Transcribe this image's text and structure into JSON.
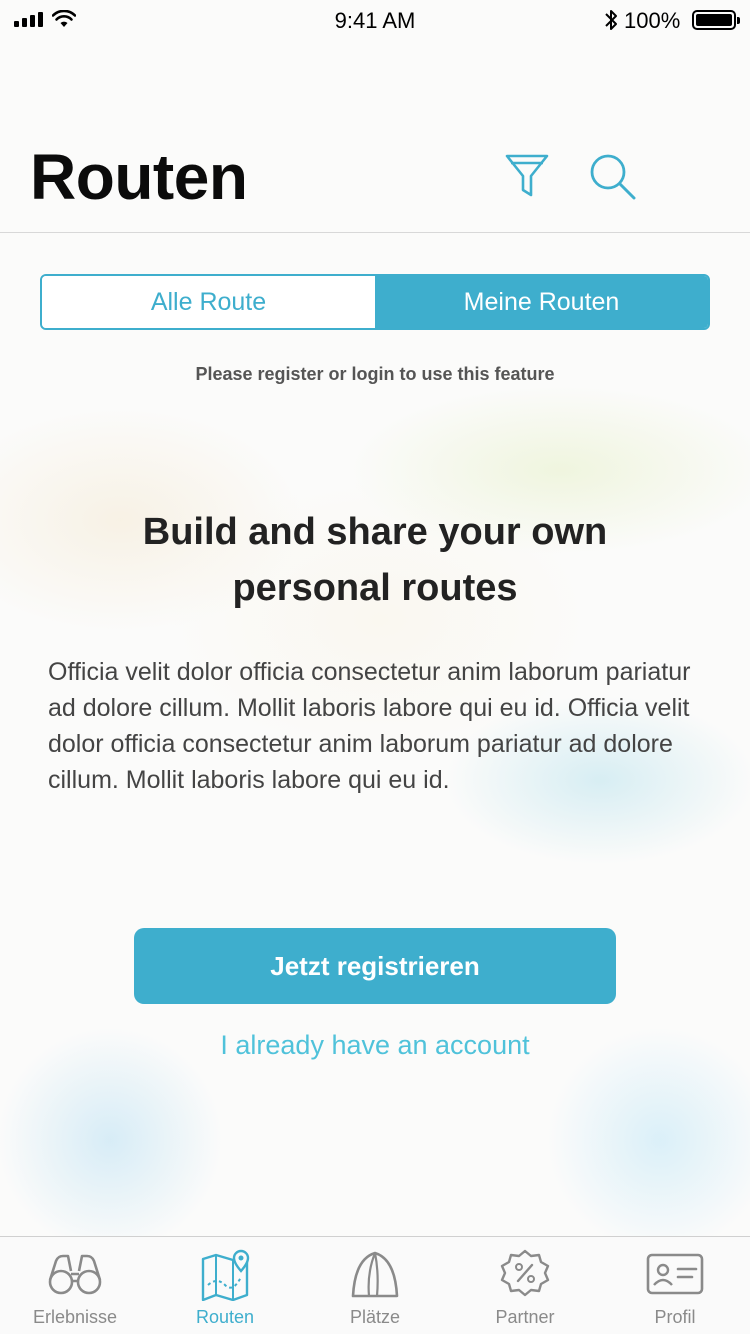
{
  "status_bar": {
    "time": "9:41 AM",
    "battery": "100%"
  },
  "header": {
    "title": "Routen",
    "filter_icon": "filter-icon",
    "search_icon": "search-icon"
  },
  "segments": [
    {
      "label": "Alle Route",
      "selected": false
    },
    {
      "label": "Meine Routen",
      "selected": true
    }
  ],
  "notice": "Please register or login to use this feature",
  "promo": {
    "headline_line1": "Build and share your own",
    "headline_line2": "personal routes",
    "body": "Officia velit dolor officia consectetur anim laborum pariatur ad dolore cillum. Mollit laboris labore qui eu id. Officia velit dolor officia consectetur anim laborum pariatur ad dolore cillum. Mollit laboris labore qui eu id."
  },
  "actions": {
    "register": "Jetzt registrieren",
    "login": "I already have an account"
  },
  "tabs": [
    {
      "label": "Erlebnisse",
      "icon": "binoculars-icon",
      "active": false
    },
    {
      "label": "Routen",
      "icon": "map-route-icon",
      "active": true
    },
    {
      "label": "Plätze",
      "icon": "tent-icon",
      "active": false
    },
    {
      "label": "Partner",
      "icon": "discount-badge-icon",
      "active": false
    },
    {
      "label": "Profil",
      "icon": "id-card-icon",
      "active": false
    }
  ],
  "colors": {
    "accent": "#3eaecd",
    "link": "#4fc2da",
    "inactive": "#8a8a8a"
  }
}
